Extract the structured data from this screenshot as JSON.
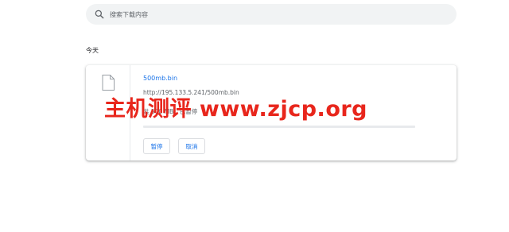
{
  "search": {
    "placeholder": "搜索下载内容",
    "icon": "search-icon"
  },
  "section": {
    "date_header": "今天"
  },
  "download": {
    "file_icon": "file-icon",
    "file_name": "500mb.bin",
    "url": "http://195.133.5.241/500mb.bin",
    "progress_text": "共 500 MB，已暂停",
    "progress_fraction": 0,
    "buttons": {
      "pause_label": "暂停",
      "cancel_label": "取消"
    }
  },
  "watermark": {
    "text": "主机测评 www.zjcp.org"
  },
  "colors": {
    "link": "#1a73e8",
    "search_bg": "#f1f3f4",
    "watermark": "#e8261c",
    "secondary_text": "#5f6368"
  }
}
